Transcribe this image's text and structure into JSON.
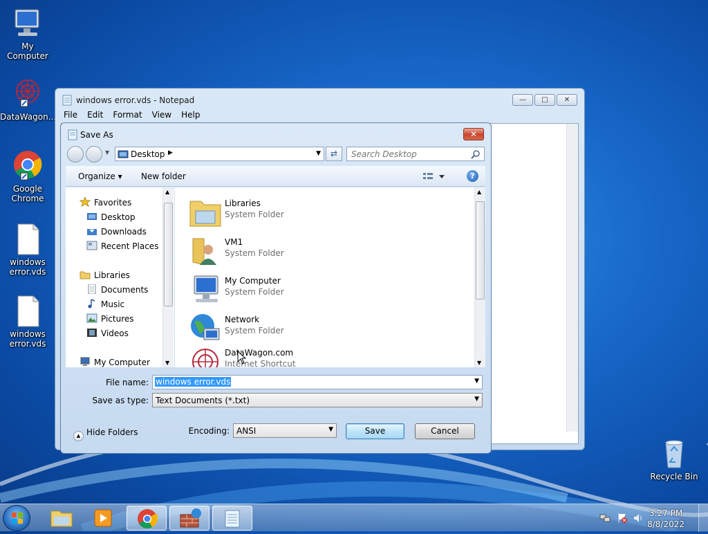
{
  "desktop": {
    "icons": [
      {
        "label": "My Computer"
      },
      {
        "label": "DataWagon..."
      },
      {
        "label": "Google Chrome"
      },
      {
        "label": "windows error.vds"
      },
      {
        "label": "windows error.vds"
      },
      {
        "label": "Recycle Bin"
      }
    ]
  },
  "notepad": {
    "title": "windows error.vds - Notepad",
    "menu": [
      "File",
      "Edit",
      "Format",
      "View",
      "Help"
    ],
    "controls": {
      "minimize": "—",
      "maximize": "□",
      "close": "✕"
    }
  },
  "dialog": {
    "title": "Save As",
    "close": "✕",
    "address": "Desktop",
    "search_placeholder": "Search Desktop",
    "toolbar": {
      "organize": "Organize ▾",
      "new_folder": "New folder"
    },
    "nav": {
      "favorites": "Favorites",
      "desktop": "Desktop",
      "downloads": "Downloads",
      "recent": "Recent Places",
      "libraries": "Libraries",
      "documents": "Documents",
      "music": "Music",
      "pictures": "Pictures",
      "videos": "Videos",
      "my_computer": "My Computer"
    },
    "files": [
      {
        "name": "Libraries",
        "type": "System Folder"
      },
      {
        "name": "VM1",
        "type": "System Folder"
      },
      {
        "name": "My Computer",
        "type": "System Folder"
      },
      {
        "name": "Network",
        "type": "System Folder"
      },
      {
        "name": "DataWagon.com",
        "type": "Internet Shortcut"
      }
    ],
    "filename_label": "File name:",
    "filename_value": "windows error.vds",
    "savetype_label": "Save as type:",
    "savetype_value": "Text Documents (*.txt)",
    "hide_folders": "Hide Folders",
    "encoding_label": "Encoding:",
    "encoding_value": "ANSI",
    "save": "Save",
    "cancel": "Cancel"
  },
  "taskbar": {
    "time": "3:27 PM",
    "date": "8/8/2022"
  }
}
